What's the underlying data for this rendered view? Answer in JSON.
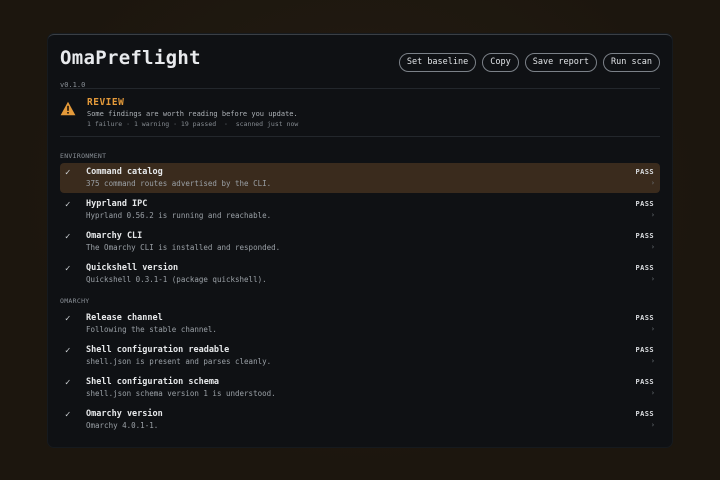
{
  "app": {
    "title": "OmaPreflight",
    "version": "v0.1.0"
  },
  "toolbar": {
    "set_baseline": "Set baseline",
    "copy": "Copy",
    "save_report": "Save report",
    "run_scan": "Run scan"
  },
  "review": {
    "icon": "warning-icon",
    "title": "REVIEW",
    "description": "Some findings are worth reading before you update.",
    "stats": "1 failure · 1 warning · 19 passed  ·  scanned just now",
    "accent": "#e49a3a"
  },
  "sections": [
    {
      "label": "ENVIRONMENT",
      "checks": [
        {
          "name": "Command catalog",
          "detail": "375 command routes advertised by the CLI.",
          "status": "PASS",
          "chevron": "›",
          "selected": true
        },
        {
          "name": "Hyprland IPC",
          "detail": "Hyprland 0.56.2 is running and reachable.",
          "status": "PASS",
          "chevron": "›"
        },
        {
          "name": "Omarchy CLI",
          "detail": "The Omarchy CLI is installed and responded.",
          "status": "PASS",
          "chevron": "›"
        },
        {
          "name": "Quickshell version",
          "detail": "Quickshell 0.3.1-1 (package quickshell).",
          "status": "PASS",
          "chevron": "›"
        }
      ]
    },
    {
      "label": "OMARCHY",
      "checks": [
        {
          "name": "Release channel",
          "detail": "Following the stable channel.",
          "status": "PASS",
          "chevron": "›"
        },
        {
          "name": "Shell configuration readable",
          "detail": "shell.json is present and parses cleanly.",
          "status": "PASS",
          "chevron": "›"
        },
        {
          "name": "Shell configuration schema",
          "detail": "shell.json schema version 1 is understood.",
          "status": "PASS",
          "chevron": "›"
        },
        {
          "name": "Omarchy version",
          "detail": "Omarchy 4.0.1-1.",
          "status": "PASS",
          "chevron": "›"
        }
      ]
    }
  ],
  "check_glyph": "✓",
  "colors": {
    "selected_row": "#3a2b1d",
    "window_bg": "#0f1114",
    "desktop_bg": "#201910"
  }
}
